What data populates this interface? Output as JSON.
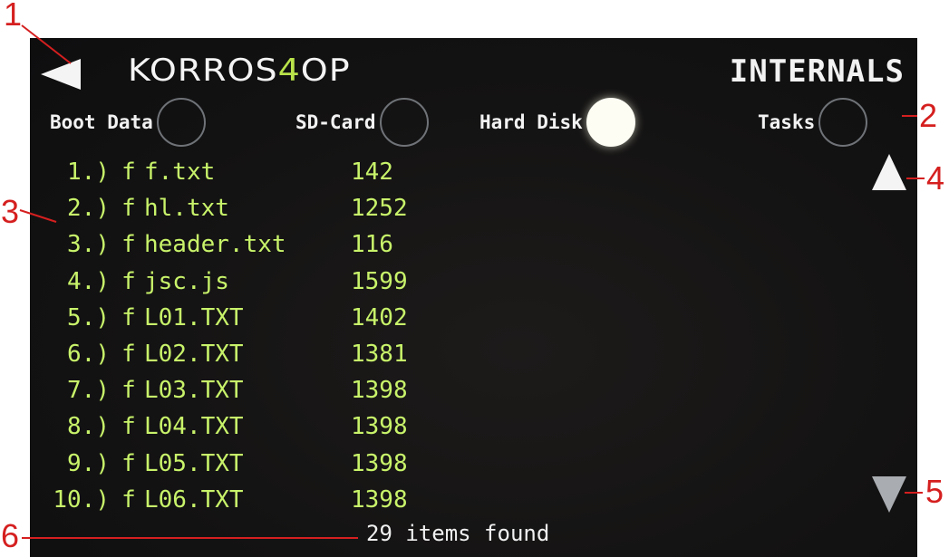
{
  "header": {
    "logo_main": "KORROS",
    "logo_accent": "4",
    "logo_tail": "OP",
    "title": "INTERNALS",
    "back_icon": "back-arrow-icon"
  },
  "tabs": [
    {
      "label": "Boot Data",
      "selected": false
    },
    {
      "label": "SD-Card",
      "selected": false
    },
    {
      "label": "Hard Disk",
      "selected": true
    },
    {
      "label": "Tasks",
      "selected": false
    }
  ],
  "files": [
    {
      "index": "1.)",
      "type": "f",
      "name": "f.txt",
      "size": "142"
    },
    {
      "index": "2.)",
      "type": "f",
      "name": "hl.txt",
      "size": "1252"
    },
    {
      "index": "3.)",
      "type": "f",
      "name": "header.txt",
      "size": "116"
    },
    {
      "index": "4.)",
      "type": "f",
      "name": "jsc.js",
      "size": "1599"
    },
    {
      "index": "5.)",
      "type": "f",
      "name": "L01.TXT",
      "size": "1402"
    },
    {
      "index": "6.)",
      "type": "f",
      "name": "L02.TXT",
      "size": "1381"
    },
    {
      "index": "7.)",
      "type": "f",
      "name": "L03.TXT",
      "size": "1398"
    },
    {
      "index": "8.)",
      "type": "f",
      "name": "L04.TXT",
      "size": "1398"
    },
    {
      "index": "9.)",
      "type": "f",
      "name": "L05.TXT",
      "size": "1398"
    },
    {
      "index": "10.)",
      "type": "f",
      "name": "L06.TXT",
      "size": "1398"
    }
  ],
  "scroll": {
    "up_icon": "scroll-up-triangle-icon",
    "down_icon": "scroll-down-triangle-icon"
  },
  "status": {
    "text": "29 items found"
  },
  "annotations": [
    "1",
    "2",
    "3",
    "4",
    "5",
    "6"
  ],
  "colors": {
    "file_text": "#c8f36a",
    "logo_accent": "#b9e34a",
    "annotation": "#d51f1f",
    "screen_bg": "#141313"
  }
}
